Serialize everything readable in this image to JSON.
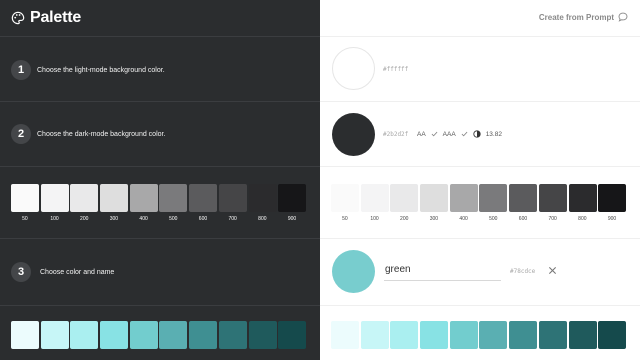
{
  "app": {
    "name": "Palette",
    "create_button": "Create from Prompt"
  },
  "steps": [
    {
      "number": "1",
      "text": "Choose the light-mode background color."
    },
    {
      "number": "2",
      "text": "Choose the dark-mode background color."
    },
    {
      "number": "3",
      "text": "Choose color and name"
    }
  ],
  "light_bg": {
    "hex": "#ffffff",
    "color": "#ffffff"
  },
  "dark_bg": {
    "hex": "#2b2d2f",
    "color": "#2b2d2f",
    "aa_label": "AA",
    "aaa_label": "AAA",
    "ratio": "13.82"
  },
  "color_entry": {
    "name": "green",
    "hex": "#78cdce",
    "color": "#78cdce"
  },
  "scale_labels": [
    "50",
    "100",
    "200",
    "300",
    "400",
    "500",
    "600",
    "700",
    "800",
    "900"
  ],
  "neutral_scale": [
    "#fafafa",
    "#f4f4f5",
    "#e9e9ea",
    "#dedede",
    "#a8a8a9",
    "#7a7a7c",
    "#5b5b5d",
    "#454547",
    "#2b2b2d",
    "#161618"
  ],
  "teal_scale": [
    "#ecfcfd",
    "#c7f6f7",
    "#aaeff0",
    "#88e2e4",
    "#72cdce",
    "#5aafb2",
    "#3f8f92",
    "#2e7376",
    "#1f5a5c",
    "#154a4c"
  ]
}
